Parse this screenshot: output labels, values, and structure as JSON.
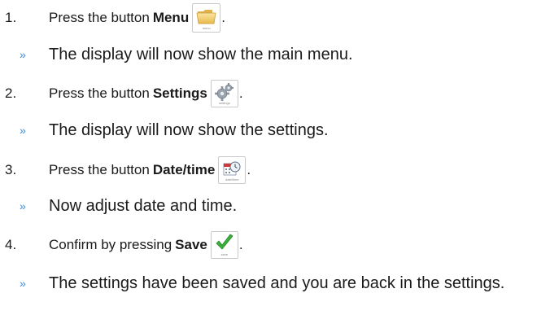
{
  "steps": [
    {
      "number": "1.",
      "text": "Press the button",
      "bold": "Menu",
      "button_caption": "menu",
      "icon": "folder-icon",
      "result": "The display will now show the main menu."
    },
    {
      "number": "2.",
      "text": "Press the button",
      "bold": "Settings",
      "button_caption": "settings",
      "icon": "gear-icon",
      "result": "The display will now show the settings."
    },
    {
      "number": "3.",
      "text": "Press the button",
      "bold": "Date/time",
      "button_caption": "date/time",
      "icon": "calendar-clock-icon",
      "result": "Now adjust date and time."
    },
    {
      "number": "4.",
      "text": "Confirm by pressing",
      "bold": "Save",
      "button_caption": "save",
      "icon": "checkmark-icon",
      "result": "The settings have been saved and you are back in the settings."
    }
  ],
  "period": ".",
  "bullet": "»",
  "colors": {
    "bullet": "#3a8ad8",
    "text": "#1a1a1a",
    "button_border": "#c9c9c9",
    "check_green": "#3cae3c"
  }
}
